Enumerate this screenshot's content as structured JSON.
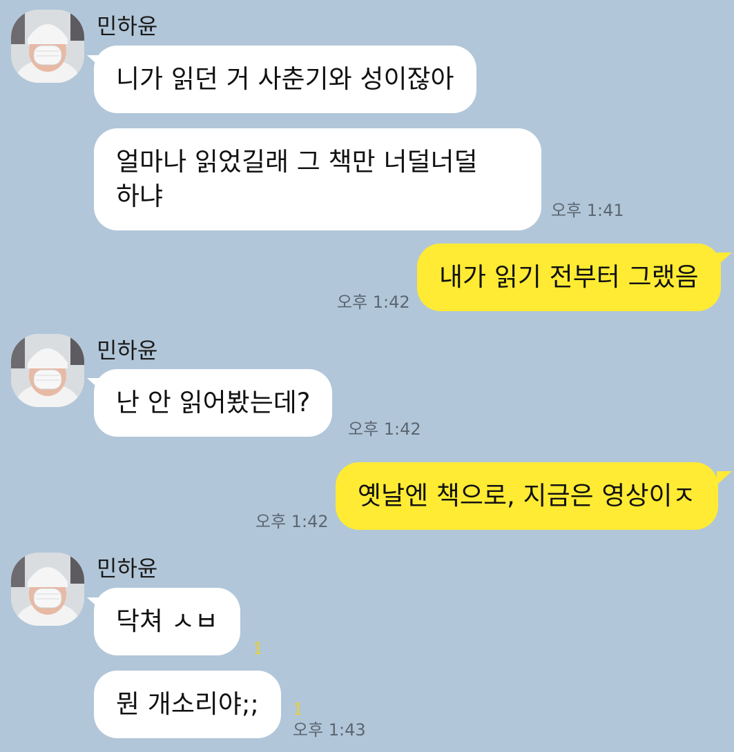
{
  "sender_name": "민하윤",
  "messages": {
    "m1": "니가 읽던 거 사춘기와 성이잖아",
    "m2": "얼마나 읽었길래 그 책만 너덜너덜\n하냐",
    "m3": "내가 읽기 전부터 그랬음",
    "m4": "난 안 읽어봤는데?",
    "m5": "옛날엔 책으로, 지금은 영상이ㅈ",
    "m6": "닥쳐 ㅅㅂ",
    "m7": "뭔 개소리야;;"
  },
  "times": {
    "t1": "오후 1:41",
    "t2": "오후 1:42",
    "t3": "오후 1:42",
    "t4": "오후 1:42",
    "t5": "오후 1:43"
  },
  "unread": {
    "u1": "1",
    "u2": "1"
  },
  "colors": {
    "background": "#b2c6d9",
    "incoming_bubble": "#ffffff",
    "outgoing_bubble": "#ffeb33",
    "unread_count": "#f0d21c"
  },
  "icons": {
    "avatar": "profile-photo"
  }
}
